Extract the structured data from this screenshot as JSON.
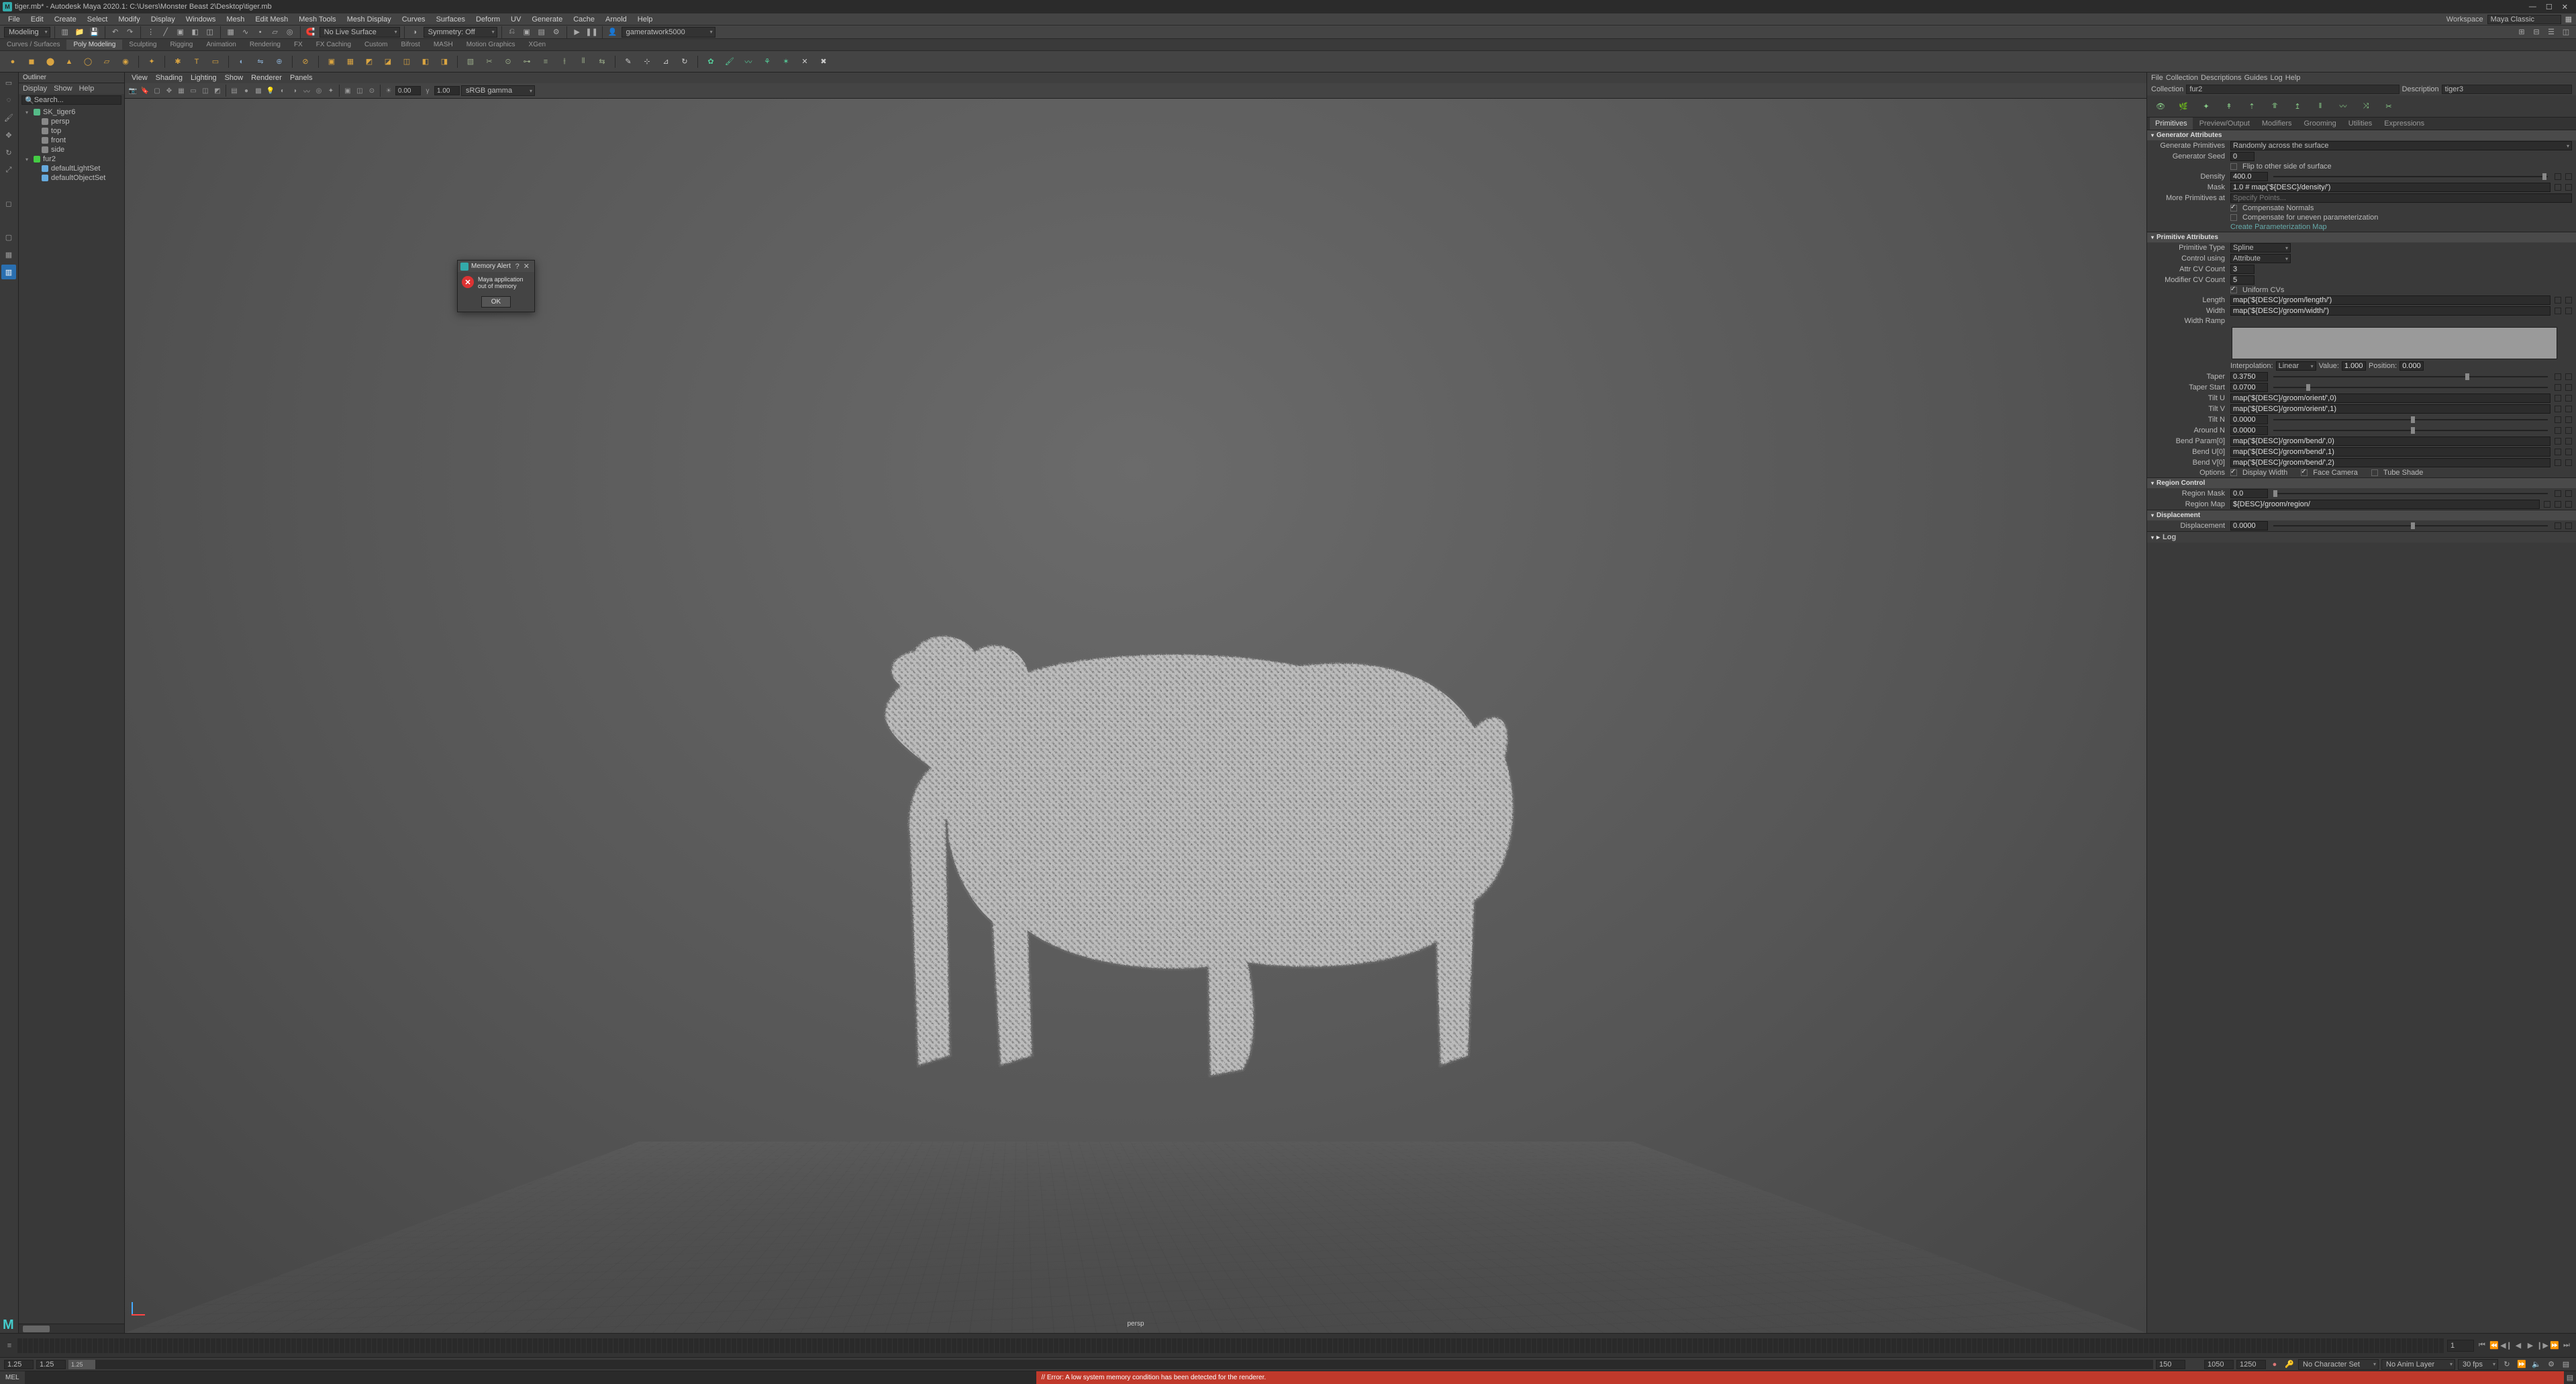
{
  "title": "tiger.mb* - Autodesk Maya 2020.1: C:\\Users\\Monster Beast 2\\Desktop\\tiger.mb",
  "workspace_label": "Workspace",
  "workspace_value": "Maya Classic",
  "menus": [
    "File",
    "Edit",
    "Create",
    "Select",
    "Modify",
    "Display",
    "Windows",
    "Mesh",
    "Edit Mesh",
    "Mesh Tools",
    "Mesh Display",
    "Curves",
    "Surfaces",
    "Deform",
    "UV",
    "Generate",
    "Cache",
    "Arnold",
    "Help"
  ],
  "moduleset": "Modeling",
  "live": "No Live Surface",
  "symmetry": "Symmetry: Off",
  "sidebar_user": "gameratwork5000",
  "shelf_tabs": [
    "Curves / Surfaces",
    "Poly Modeling",
    "Sculpting",
    "Rigging",
    "Animation",
    "Rendering",
    "FX",
    "FX Caching",
    "Custom",
    "Bifrost",
    "MASH",
    "Motion Graphics",
    "XGen"
  ],
  "shelf_active": 1,
  "outliner": {
    "title": "Outliner",
    "menus": [
      "Display",
      "Show",
      "Help"
    ],
    "search_ph": "Search...",
    "items": [
      {
        "label": "SK_tiger6",
        "icon": "#5b8",
        "type": "mesh",
        "exp": true
      },
      {
        "label": "persp",
        "icon": "#888",
        "type": "cam",
        "sub": true
      },
      {
        "label": "top",
        "icon": "#888",
        "type": "cam",
        "sub": true
      },
      {
        "label": "front",
        "icon": "#888",
        "type": "cam",
        "sub": true
      },
      {
        "label": "side",
        "icon": "#888",
        "type": "cam",
        "sub": true
      },
      {
        "label": "fur2",
        "icon": "#4c4",
        "type": "xgen",
        "exp": true
      },
      {
        "label": "defaultLightSet",
        "icon": "#6ad",
        "type": "set",
        "sub": true
      },
      {
        "label": "defaultObjectSet",
        "icon": "#6ad",
        "type": "set",
        "sub": true
      }
    ]
  },
  "viewport": {
    "menus": [
      "View",
      "Shading",
      "Lighting",
      "Show",
      "Renderer",
      "Panels"
    ],
    "num1": "0.00",
    "num2": "1.00",
    "colorspace": "sRGB gamma",
    "camera": "persp"
  },
  "ae": {
    "menus": [
      "File",
      "Collection",
      "Descriptions",
      "Guides",
      "Log",
      "Help"
    ],
    "collection_lbl": "Collection",
    "collection": "fur2",
    "description_lbl": "Description",
    "description": "tiger3",
    "tabs": [
      "Primitives",
      "Preview/Output",
      "Modifiers",
      "Grooming",
      "Utilities",
      "Expressions"
    ],
    "active_tab": 0,
    "gen": {
      "title": "Generator Attributes",
      "gen_prim_lbl": "Generate Primitives",
      "gen_prim": "Randomly across the surface",
      "seed_lbl": "Generator Seed",
      "seed": "0",
      "flip": "Flip to other side of surface",
      "density_lbl": "Density",
      "density": "400.0",
      "mask_lbl": "Mask",
      "mask": "1.0 # map('${DESC}/density/')",
      "more_lbl": "More Primitives at",
      "more_ph": "Specify Points...",
      "comp_norm": "Compensate Normals",
      "comp_unev": "Compensate for uneven parameterization",
      "create_map": "Create Parameterization Map"
    },
    "prim": {
      "title": "Primitive Attributes",
      "type_lbl": "Primitive Type",
      "type": "Spline",
      "ctrl_lbl": "Control using",
      "ctrl": "Attribute",
      "attrcv_lbl": "Attr CV Count",
      "attrcv": "3",
      "modcv_lbl": "Modifier CV Count",
      "modcv": "5",
      "uniform": "Uniform CVs",
      "length_lbl": "Length",
      "length": "map('${DESC}/groom/length/')",
      "width_lbl": "Width",
      "width": "map('${DESC}/groom/width/')",
      "ramp_lbl": "Width Ramp",
      "interp_lbl": "Interpolation:",
      "interp": "Linear",
      "val_lbl": "Value:",
      "val": "1.000",
      "pos_lbl": "Position:",
      "pos": "0.000",
      "taper_lbl": "Taper",
      "taper": "0.3750",
      "taperstart_lbl": "Taper Start",
      "taperstart": "0.0700",
      "tiltu_lbl": "Tilt U",
      "tiltu": "map('${DESC}/groom/orient/',0)",
      "tiltv_lbl": "Tilt V",
      "tiltv": "map('${DESC}/groom/orient/',1)",
      "tiltn_lbl": "Tilt N",
      "tiltn": "0.0000",
      "aroundn_lbl": "Around N",
      "aroundn": "0.0000",
      "bendp_lbl": "Bend Param[0]",
      "bendp": "map('${DESC}/groom/bend/',0)",
      "bendu_lbl": "Bend U[0]",
      "bendu": "map('${DESC}/groom/bend/',1)",
      "bendv_lbl": "Bend V[0]",
      "bendv": "map('${DESC}/groom/bend/',2)",
      "opts_lbl": "Options",
      "opt1": "Display Width",
      "opt2": "Face Camera",
      "opt3": "Tube Shade"
    },
    "region": {
      "title": "Region Control",
      "mask_lbl": "Region Mask",
      "mask": "0.0",
      "map_lbl": "Region Map",
      "map": "${DESC}/groom/region/"
    },
    "disp": {
      "title": "Displacement",
      "lbl": "Displacement",
      "val": "0.0000"
    },
    "log_title": "Log"
  },
  "dialog": {
    "title": "Memory Alert",
    "msg": "Maya application out of memory",
    "ok": "OK"
  },
  "timeline": {
    "cur": "1",
    "cur2": ""
  },
  "range": {
    "start_outer": "1.25",
    "start": "1.25",
    "thumb": "1.25",
    "end": "150",
    "end2": "1050",
    "end3": "1250",
    "charset": "No Character Set",
    "animlayer": "No Anim Layer",
    "fps": "30 fps"
  },
  "cmd": {
    "lang": "MEL",
    "error": "// Error: A low system memory condition has been detected for the renderer."
  },
  "logo": "M"
}
